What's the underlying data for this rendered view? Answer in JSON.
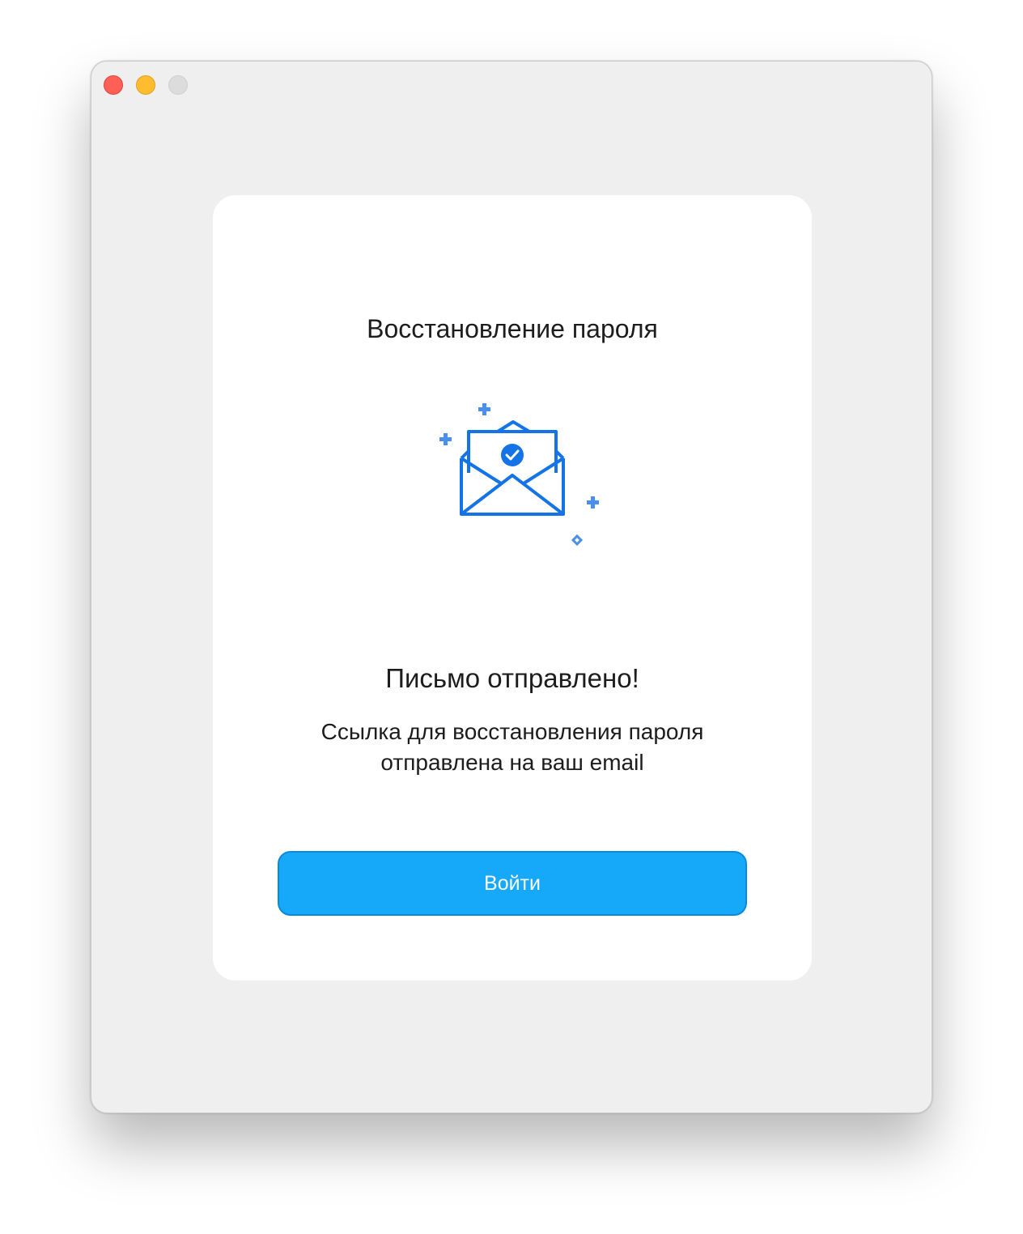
{
  "window": {
    "traffic_lights": {
      "close_color": "#fe5f57",
      "minimize_color": "#febc2e",
      "zoom_color": "#dcdcdc"
    }
  },
  "card": {
    "title": "Восстановление пароля",
    "illustration": {
      "icon": "envelope-with-check-icon",
      "accent_color": "#1473e6"
    },
    "status_heading": "Письмо отправлено!",
    "status_message_lines": [
      "Ссылка для восстановления пароля",
      "отправлена на ваш email"
    ],
    "login_button_label": "Войти",
    "button_color": "#16a9fa"
  }
}
